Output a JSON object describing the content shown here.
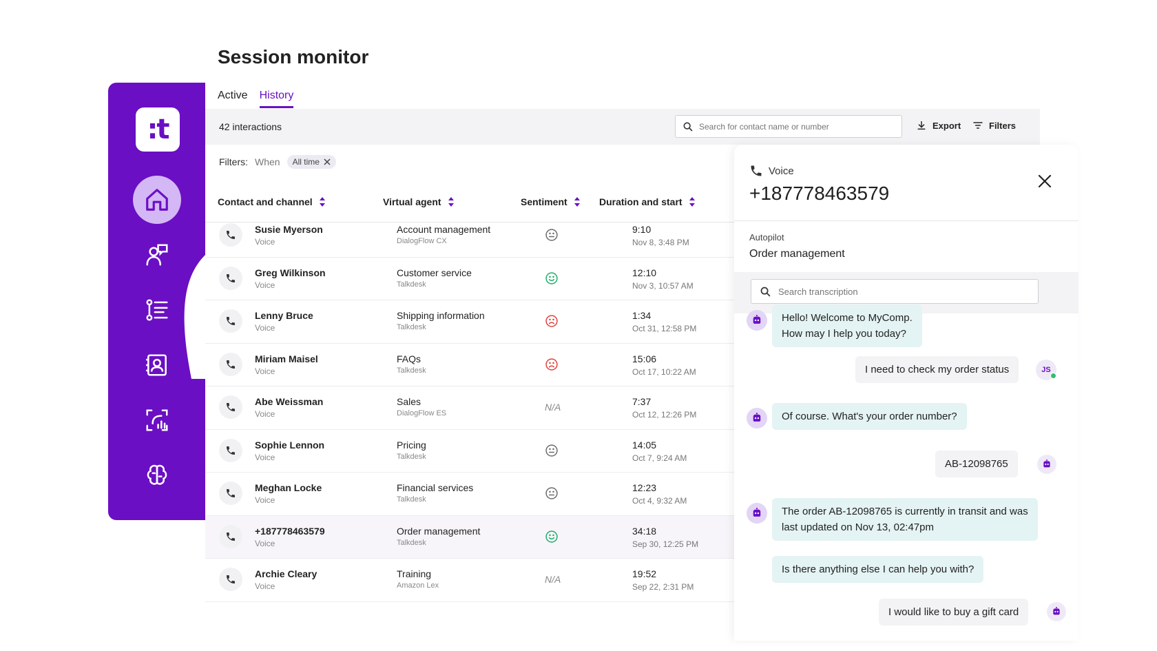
{
  "app": {
    "logo_text": ":t",
    "title": "Session monitor"
  },
  "sidebar": {
    "items": [
      {
        "icon": "home-icon",
        "active": true
      },
      {
        "icon": "agent-chat-icon",
        "active": false
      },
      {
        "icon": "list-icon",
        "active": false
      },
      {
        "icon": "contacts-icon",
        "active": false
      },
      {
        "icon": "analytics-icon",
        "active": false
      },
      {
        "icon": "brain-icon",
        "active": false
      }
    ],
    "accent": "#6a0fc4"
  },
  "tabs": [
    {
      "label": "Active",
      "active": false
    },
    {
      "label": "History",
      "active": true
    }
  ],
  "toolbar": {
    "count": "42 interactions",
    "search_placeholder": "Search for contact name or number",
    "export_label": "Export",
    "filters_label": "Filters"
  },
  "filters": {
    "label": "Filters:",
    "when_label": "When",
    "chip": "All time"
  },
  "table": {
    "columns": [
      "Contact and channel",
      "Virtual agent",
      "Sentiment",
      "Duration and start"
    ],
    "rows": [
      {
        "name": "Susie Myerson",
        "channel": "Voice",
        "agent": "Account management",
        "platform": "DialogFlow CX",
        "sentiment": "neutral",
        "duration": "9:10",
        "start": "Nov 8, 3:48 PM"
      },
      {
        "name": "Greg Wilkinson",
        "channel": "Voice",
        "agent": "Customer service",
        "platform": "Talkdesk",
        "sentiment": "positive",
        "duration": "12:10",
        "start": "Nov 3, 10:57 AM"
      },
      {
        "name": "Lenny Bruce",
        "channel": "Voice",
        "agent": "Shipping information",
        "platform": "Talkdesk",
        "sentiment": "negative",
        "duration": "1:34",
        "start": "Oct 31, 12:58 PM"
      },
      {
        "name": "Miriam Maisel",
        "channel": "Voice",
        "agent": "FAQs",
        "platform": "Talkdesk",
        "sentiment": "negative",
        "duration": "15:06",
        "start": "Oct 17, 10:22 AM"
      },
      {
        "name": "Abe Weissman",
        "channel": "Voice",
        "agent": "Sales",
        "platform": "DialogFlow ES",
        "sentiment": "N/A",
        "duration": "7:37",
        "start": "Oct 12, 12:26 PM"
      },
      {
        "name": "Sophie Lennon",
        "channel": "Voice",
        "agent": "Pricing",
        "platform": "Talkdesk",
        "sentiment": "neutral",
        "duration": "14:05",
        "start": "Oct 7, 9:24 AM"
      },
      {
        "name": "Meghan Locke",
        "channel": "Voice",
        "agent": "Financial services",
        "platform": "Talkdesk",
        "sentiment": "neutral",
        "duration": "12:23",
        "start": "Oct 4, 9:32 AM"
      },
      {
        "name": "+187778463579",
        "channel": "Voice",
        "agent": "Order management",
        "platform": "Talkdesk",
        "sentiment": "positive",
        "duration": "34:18",
        "start": "Sep 30, 12:25 PM"
      },
      {
        "name": "Archie Cleary",
        "channel": "Voice",
        "agent": "Training",
        "platform": "Amazon Lex",
        "sentiment": "N/A",
        "duration": "19:52",
        "start": "Sep 22, 2:31 PM"
      }
    ],
    "sentiment_colors": {
      "neutral": "#6b6b6b",
      "positive": "#1fae6a",
      "negative": "#e0413b"
    }
  },
  "detail": {
    "channel": "Voice",
    "number": "+187778463579",
    "autopilot_label": "Autopilot",
    "autopilot_value": "Order management",
    "search_placeholder": "Search transcription",
    "messages": [
      {
        "from": "bot",
        "text_lines": [
          "Hello! Welcome to MyComp.",
          "How may I help you today?"
        ]
      },
      {
        "from": "user",
        "text": "I need to check my order status",
        "avatar": "JS"
      },
      {
        "from": "bot",
        "text": "Of course. What's your order number?"
      },
      {
        "from": "user",
        "text": "AB-12098765"
      },
      {
        "from": "bot",
        "text_lines": [
          "The order AB-12098765 is currently in transit and was",
          "last updated on Nov 13, 02:47pm"
        ]
      },
      {
        "from": "bot",
        "text": "Is there anything else I can help you with?"
      },
      {
        "from": "user",
        "text": "I would like to buy a gift card"
      }
    ]
  }
}
